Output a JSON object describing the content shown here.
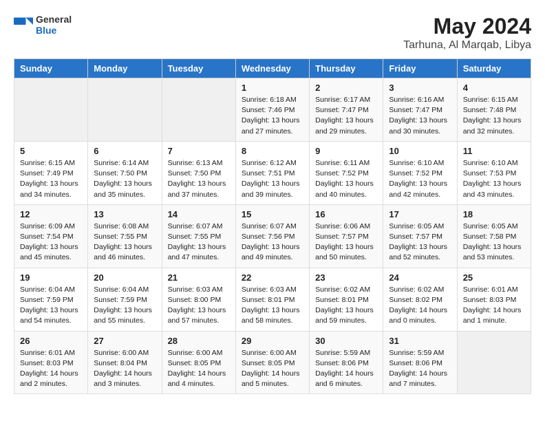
{
  "header": {
    "logo_general": "General",
    "logo_blue": "Blue",
    "month_year": "May 2024",
    "location": "Tarhuna, Al Marqab, Libya"
  },
  "days_of_week": [
    "Sunday",
    "Monday",
    "Tuesday",
    "Wednesday",
    "Thursday",
    "Friday",
    "Saturday"
  ],
  "weeks": [
    [
      {
        "day": "",
        "text": ""
      },
      {
        "day": "",
        "text": ""
      },
      {
        "day": "",
        "text": ""
      },
      {
        "day": "1",
        "text": "Sunrise: 6:18 AM\nSunset: 7:46 PM\nDaylight: 13 hours\nand 27 minutes."
      },
      {
        "day": "2",
        "text": "Sunrise: 6:17 AM\nSunset: 7:47 PM\nDaylight: 13 hours\nand 29 minutes."
      },
      {
        "day": "3",
        "text": "Sunrise: 6:16 AM\nSunset: 7:47 PM\nDaylight: 13 hours\nand 30 minutes."
      },
      {
        "day": "4",
        "text": "Sunrise: 6:15 AM\nSunset: 7:48 PM\nDaylight: 13 hours\nand 32 minutes."
      }
    ],
    [
      {
        "day": "5",
        "text": "Sunrise: 6:15 AM\nSunset: 7:49 PM\nDaylight: 13 hours\nand 34 minutes."
      },
      {
        "day": "6",
        "text": "Sunrise: 6:14 AM\nSunset: 7:50 PM\nDaylight: 13 hours\nand 35 minutes."
      },
      {
        "day": "7",
        "text": "Sunrise: 6:13 AM\nSunset: 7:50 PM\nDaylight: 13 hours\nand 37 minutes."
      },
      {
        "day": "8",
        "text": "Sunrise: 6:12 AM\nSunset: 7:51 PM\nDaylight: 13 hours\nand 39 minutes."
      },
      {
        "day": "9",
        "text": "Sunrise: 6:11 AM\nSunset: 7:52 PM\nDaylight: 13 hours\nand 40 minutes."
      },
      {
        "day": "10",
        "text": "Sunrise: 6:10 AM\nSunset: 7:52 PM\nDaylight: 13 hours\nand 42 minutes."
      },
      {
        "day": "11",
        "text": "Sunrise: 6:10 AM\nSunset: 7:53 PM\nDaylight: 13 hours\nand 43 minutes."
      }
    ],
    [
      {
        "day": "12",
        "text": "Sunrise: 6:09 AM\nSunset: 7:54 PM\nDaylight: 13 hours\nand 45 minutes."
      },
      {
        "day": "13",
        "text": "Sunrise: 6:08 AM\nSunset: 7:55 PM\nDaylight: 13 hours\nand 46 minutes."
      },
      {
        "day": "14",
        "text": "Sunrise: 6:07 AM\nSunset: 7:55 PM\nDaylight: 13 hours\nand 47 minutes."
      },
      {
        "day": "15",
        "text": "Sunrise: 6:07 AM\nSunset: 7:56 PM\nDaylight: 13 hours\nand 49 minutes."
      },
      {
        "day": "16",
        "text": "Sunrise: 6:06 AM\nSunset: 7:57 PM\nDaylight: 13 hours\nand 50 minutes."
      },
      {
        "day": "17",
        "text": "Sunrise: 6:05 AM\nSunset: 7:57 PM\nDaylight: 13 hours\nand 52 minutes."
      },
      {
        "day": "18",
        "text": "Sunrise: 6:05 AM\nSunset: 7:58 PM\nDaylight: 13 hours\nand 53 minutes."
      }
    ],
    [
      {
        "day": "19",
        "text": "Sunrise: 6:04 AM\nSunset: 7:59 PM\nDaylight: 13 hours\nand 54 minutes."
      },
      {
        "day": "20",
        "text": "Sunrise: 6:04 AM\nSunset: 7:59 PM\nDaylight: 13 hours\nand 55 minutes."
      },
      {
        "day": "21",
        "text": "Sunrise: 6:03 AM\nSunset: 8:00 PM\nDaylight: 13 hours\nand 57 minutes."
      },
      {
        "day": "22",
        "text": "Sunrise: 6:03 AM\nSunset: 8:01 PM\nDaylight: 13 hours\nand 58 minutes."
      },
      {
        "day": "23",
        "text": "Sunrise: 6:02 AM\nSunset: 8:01 PM\nDaylight: 13 hours\nand 59 minutes."
      },
      {
        "day": "24",
        "text": "Sunrise: 6:02 AM\nSunset: 8:02 PM\nDaylight: 14 hours\nand 0 minutes."
      },
      {
        "day": "25",
        "text": "Sunrise: 6:01 AM\nSunset: 8:03 PM\nDaylight: 14 hours\nand 1 minute."
      }
    ],
    [
      {
        "day": "26",
        "text": "Sunrise: 6:01 AM\nSunset: 8:03 PM\nDaylight: 14 hours\nand 2 minutes."
      },
      {
        "day": "27",
        "text": "Sunrise: 6:00 AM\nSunset: 8:04 PM\nDaylight: 14 hours\nand 3 minutes."
      },
      {
        "day": "28",
        "text": "Sunrise: 6:00 AM\nSunset: 8:05 PM\nDaylight: 14 hours\nand 4 minutes."
      },
      {
        "day": "29",
        "text": "Sunrise: 6:00 AM\nSunset: 8:05 PM\nDaylight: 14 hours\nand 5 minutes."
      },
      {
        "day": "30",
        "text": "Sunrise: 5:59 AM\nSunset: 8:06 PM\nDaylight: 14 hours\nand 6 minutes."
      },
      {
        "day": "31",
        "text": "Sunrise: 5:59 AM\nSunset: 8:06 PM\nDaylight: 14 hours\nand 7 minutes."
      },
      {
        "day": "",
        "text": ""
      }
    ]
  ]
}
